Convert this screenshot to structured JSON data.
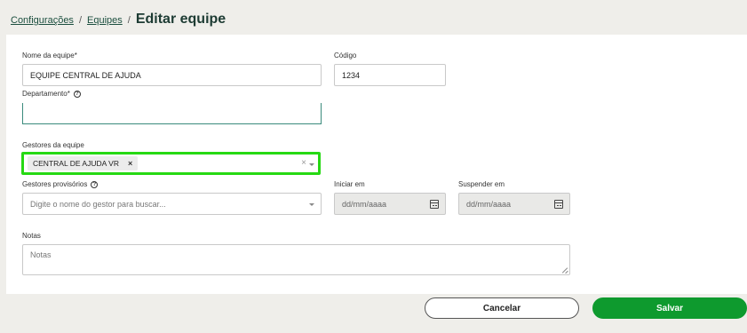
{
  "breadcrumb": {
    "items": [
      "Configurações",
      "Equipes"
    ],
    "separator": "/",
    "current": "Editar equipe"
  },
  "form": {
    "team_name": {
      "label": "Nome da equipe*",
      "value": "EQUIPE CENTRAL DE AJUDA"
    },
    "code": {
      "label": "Código",
      "value": "1234"
    },
    "department": {
      "label": "Departamento*",
      "value": ""
    },
    "managers": {
      "label": "Gestores da equipe",
      "chips": [
        "CENTRAL DE AJUDA VR"
      ],
      "chip_remove": "×",
      "clear": "×"
    },
    "temp_managers": {
      "label": "Gestores provisórios",
      "placeholder": "Digite o nome do gestor para buscar..."
    },
    "start": {
      "label": "Iniciar em",
      "placeholder": "dd/mm/aaaa"
    },
    "suspend": {
      "label": "Suspender em",
      "placeholder": "dd/mm/aaaa"
    },
    "notes": {
      "label": "Notas",
      "placeholder": "Notas"
    }
  },
  "actions": {
    "cancel": "Cancelar",
    "save": "Salvar"
  },
  "colors": {
    "highlight": "#26d913",
    "primary": "#0e9a2e",
    "brand_text": "#1d3b33"
  },
  "icons": [
    "help-icon",
    "chevron-down-icon",
    "calendar-icon",
    "close-icon",
    "resize-handle-icon"
  ]
}
